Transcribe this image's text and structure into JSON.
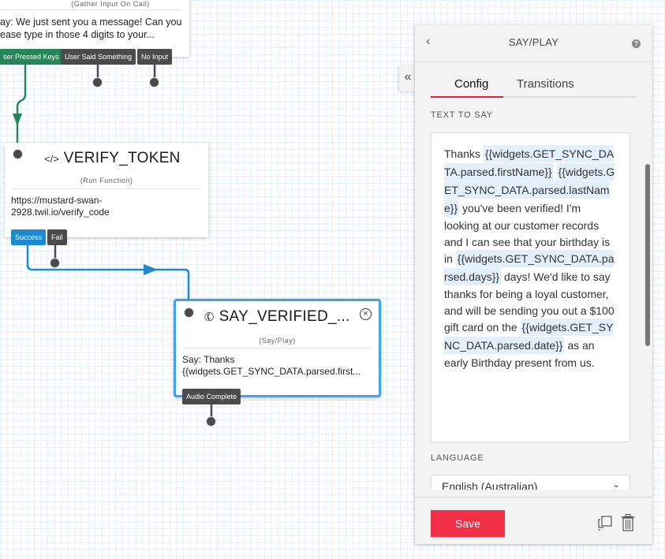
{
  "canvas": {
    "gather_node": {
      "subtitle": "(Gather Input On Call)",
      "body": "ay: We just sent you a message! Can you\nease type in those 4 digits to your...",
      "ports": [
        "ser Pressed Keys",
        "User Said Something",
        "No Input"
      ]
    },
    "verify_node": {
      "icon": "code-icon",
      "title": "VERIFY_TOKEN",
      "subtitle": "(Run Function)",
      "body": "https://mustard-swan-\n2928.twil.io/verify_code",
      "ports": [
        "Success",
        "Fail"
      ]
    },
    "say_node": {
      "icon": "phone-icon",
      "title": "SAY_VERIFIED_...",
      "subtitle": "(Say/Play)",
      "body": "Say: Thanks\n{{widgets.GET_SYNC_DATA.parsed.first...",
      "ports": [
        "Audio Complete"
      ]
    }
  },
  "panel": {
    "title": "SAY/PLAY",
    "back_icon": "‹",
    "help_icon": "?",
    "collapse_icon": "«",
    "tabs": [
      {
        "label": "Config",
        "active": true
      },
      {
        "label": "Transitions",
        "active": false
      }
    ],
    "text_to_say_label": "TEXT TO SAY",
    "text_to_say": [
      {
        "t": "text",
        "v": "Thanks "
      },
      {
        "t": "token",
        "v": "{{widgets.GET_SYNC_DATA.parsed.firstName}}"
      },
      {
        "t": "text",
        "v": " "
      },
      {
        "t": "token",
        "v": "{{widgets.GET_SYNC_DATA.parsed.lastName}}"
      },
      {
        "t": "text",
        "v": " you've been verified! I'm looking at our customer records and I can see that your birthday is in "
      },
      {
        "t": "token",
        "v": "{{widgets.GET_SYNC_DATA.parsed.days}}"
      },
      {
        "t": "text",
        "v": " days! We'd like to say thanks for being a loyal customer, and will be sending you out a $100 gift card on the "
      },
      {
        "t": "token",
        "v": "{{widgets.GET_SYNC_DATA.parsed.date}}"
      },
      {
        "t": "text",
        "v": " as an early Birthday present from us."
      }
    ],
    "language_label": "LANGUAGE",
    "language_value": "English (Australian)",
    "save_label": "Save"
  },
  "colors": {
    "accent_red": "#f22f46",
    "success_blue": "#1b8ad0",
    "keys_green": "#23875a",
    "port_gray": "#4b4b4b"
  }
}
